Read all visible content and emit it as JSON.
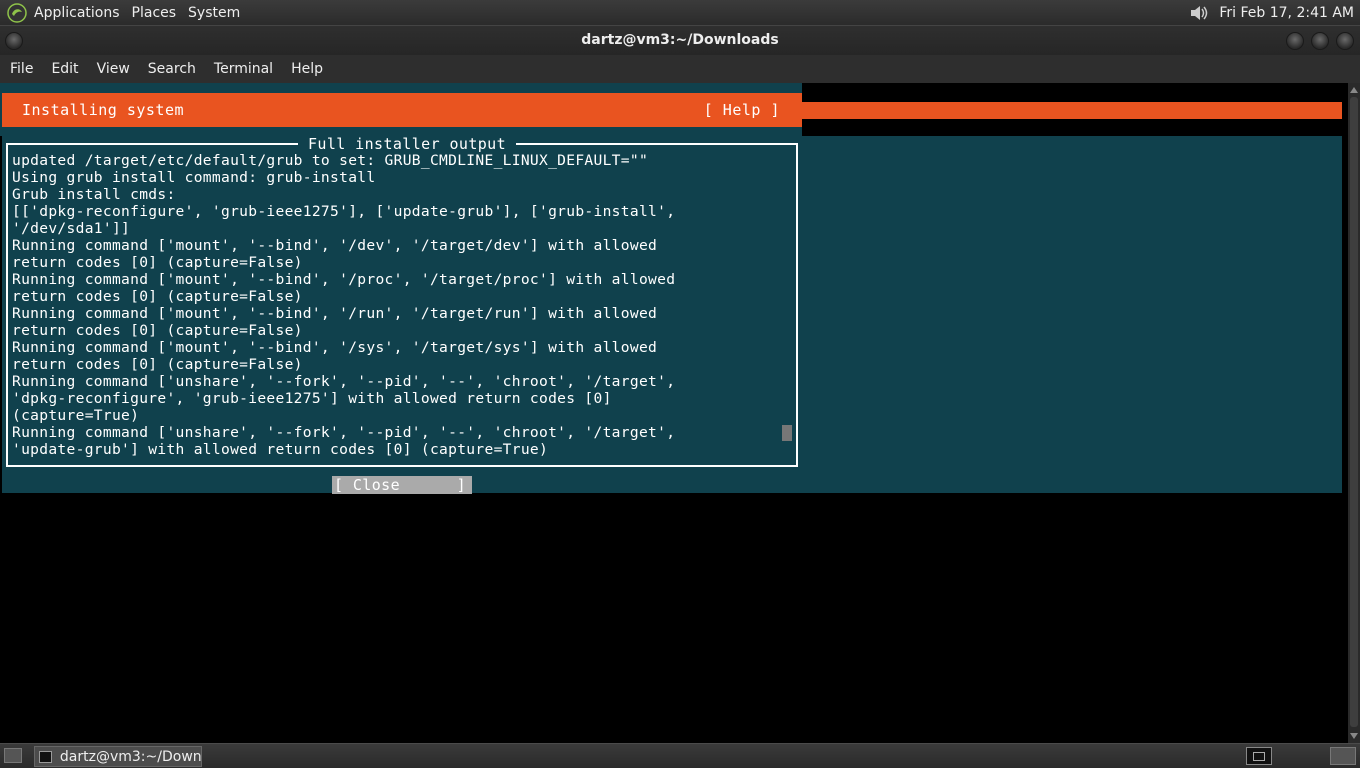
{
  "top_panel": {
    "menus": [
      "Applications",
      "Places",
      "System"
    ],
    "clock": "Fri Feb 17,  2:41 AM"
  },
  "window": {
    "title": "dartz@vm3:~/Downloads"
  },
  "menubar": {
    "items": [
      "File",
      "Edit",
      "View",
      "Search",
      "Terminal",
      "Help"
    ]
  },
  "installer": {
    "header_title": "Installing system",
    "help_label": "[ Help ]",
    "box_title": "Full installer output",
    "log_lines": [
      "updated /target/etc/default/grub to set: GRUB_CMDLINE_LINUX_DEFAULT=\"\"",
      "Using grub install command: grub-install",
      "Grub install cmds:",
      "[['dpkg-reconfigure', 'grub-ieee1275'], ['update-grub'], ['grub-install',",
      "'/dev/sda1']]",
      "Running command ['mount', '--bind', '/dev', '/target/dev'] with allowed",
      "return codes [0] (capture=False)",
      "Running command ['mount', '--bind', '/proc', '/target/proc'] with allowed",
      "return codes [0] (capture=False)",
      "Running command ['mount', '--bind', '/run', '/target/run'] with allowed",
      "return codes [0] (capture=False)",
      "Running command ['mount', '--bind', '/sys', '/target/sys'] with allowed",
      "return codes [0] (capture=False)",
      "Running command ['unshare', '--fork', '--pid', '--', 'chroot', '/target',",
      "'dpkg-reconfigure', 'grub-ieee1275'] with allowed return codes [0]",
      "(capture=True)",
      "Running command ['unshare', '--fork', '--pid', '--', 'chroot', '/target',",
      "'update-grub'] with allowed return codes [0] (capture=True)"
    ],
    "close_label": "[ Close      ]"
  },
  "taskbar": {
    "task_label": "dartz@vm3:~/Down..."
  },
  "colors": {
    "accent_orange": "#e95420",
    "teal_background": "#10414d"
  }
}
